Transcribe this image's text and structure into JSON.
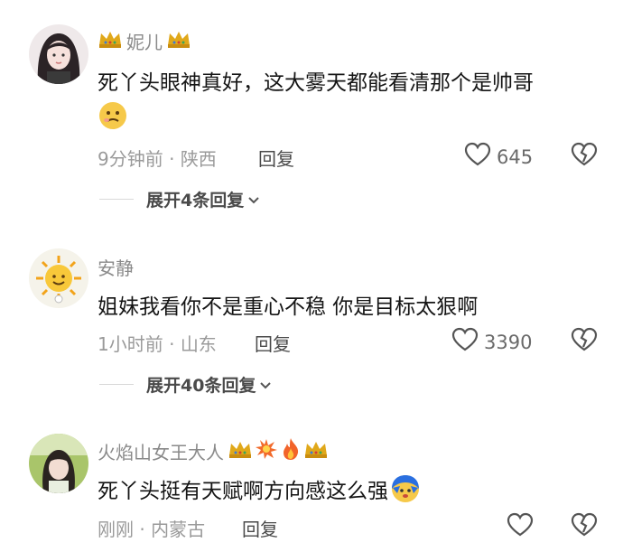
{
  "comments": [
    {
      "username": "妮儿",
      "text": "死丫头眼神真好，这大雾天都能看清那个是帅哥",
      "time": "9分钟前",
      "location": "陕西",
      "reply_label": "回复",
      "likes": "645",
      "expand_label": "展开4条回复",
      "name_icons": [
        "crown-icon",
        "crown-icon"
      ],
      "emoji": "thinking-emoji"
    },
    {
      "username": "安静",
      "text": "姐妹我看你不是重心不稳 你是目标太狠啊",
      "time": "1小时前",
      "location": "山东",
      "reply_label": "回复",
      "likes": "3390",
      "expand_label": "展开40条回复"
    },
    {
      "username": "火焰山女王大人",
      "text": "死丫头挺有天赋啊方向感这么强",
      "time": "刚刚",
      "location": "内蒙古",
      "reply_label": "回复",
      "likes": "",
      "name_icons": [
        "crown-icon",
        "boom-icon",
        "fire-icon",
        "crown-icon"
      ],
      "emoji": "blue-face-emoji"
    }
  ],
  "separator": " · ",
  "colors": {
    "meta": "#9a9a9a",
    "text": "#151515",
    "name": "#8a8a8a"
  }
}
